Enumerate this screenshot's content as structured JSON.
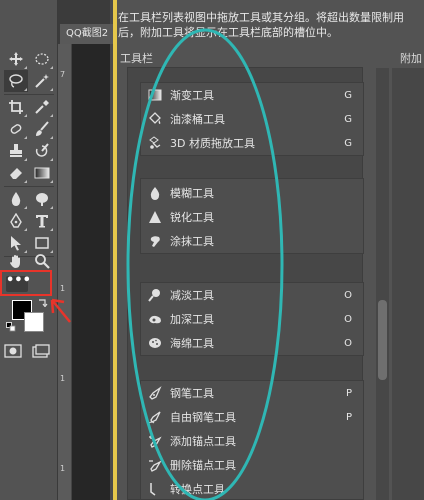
{
  "document": {
    "tab_title": "QQ截图2"
  },
  "ruler": {
    "marks": [
      "7",
      "1",
      "1",
      "1"
    ]
  },
  "toolbar": {
    "more_label": "•••",
    "foreground_color": "#000000",
    "background_color": "#ffffff",
    "tools": [
      "move-tool",
      "marquee-tool",
      "lasso-tool",
      "magic-wand-tool",
      "crop-tool",
      "eyedropper-tool",
      "healing-brush-tool",
      "brush-tool",
      "clone-stamp-tool",
      "history-brush-tool",
      "eraser-tool",
      "gradient-tool",
      "blur-tool",
      "dodge-tool",
      "pen-tool",
      "type-tool",
      "path-selection-tool",
      "rectangle-tool",
      "hand-tool",
      "zoom-tool"
    ]
  },
  "dialog": {
    "description": "在工具栏列表视图中拖放工具或其分组。将超出数量限制用后，附加工具将显示在工具栏底部的槽位中。",
    "toolbar_heading": "工具栏",
    "extra_heading": "附加",
    "groups": [
      {
        "items": [
          {
            "icon": "gradient-icon",
            "label": "渐变工具",
            "key": "G"
          },
          {
            "icon": "paint-bucket-icon",
            "label": "油漆桶工具",
            "key": "G"
          },
          {
            "icon": "3d-material-drop-icon",
            "label": "3D 材质拖放工具",
            "key": "G"
          }
        ]
      },
      {
        "items": [
          {
            "icon": "blur-drop-icon",
            "label": "模糊工具",
            "key": ""
          },
          {
            "icon": "sharpen-triangle-icon",
            "label": "锐化工具",
            "key": ""
          },
          {
            "icon": "smudge-finger-icon",
            "label": "涂抹工具",
            "key": ""
          }
        ]
      },
      {
        "items": [
          {
            "icon": "dodge-icon",
            "label": "减淡工具",
            "key": "O"
          },
          {
            "icon": "burn-icon",
            "label": "加深工具",
            "key": "O"
          },
          {
            "icon": "sponge-icon",
            "label": "海绵工具",
            "key": "O"
          }
        ]
      },
      {
        "items": [
          {
            "icon": "pen-icon",
            "label": "钢笔工具",
            "key": "P"
          },
          {
            "icon": "freeform-pen-icon",
            "label": "自由钢笔工具",
            "key": "P"
          },
          {
            "icon": "add-anchor-icon",
            "label": "添加锚点工具",
            "key": ""
          },
          {
            "icon": "delete-anchor-icon",
            "label": "删除锚点工具",
            "key": ""
          },
          {
            "icon": "convert-point-icon",
            "label": "转换点工具",
            "key": ""
          }
        ]
      }
    ]
  },
  "annotations": {
    "ellipse_color": "#2fb7b4",
    "highlight_color": "#e8342a"
  }
}
